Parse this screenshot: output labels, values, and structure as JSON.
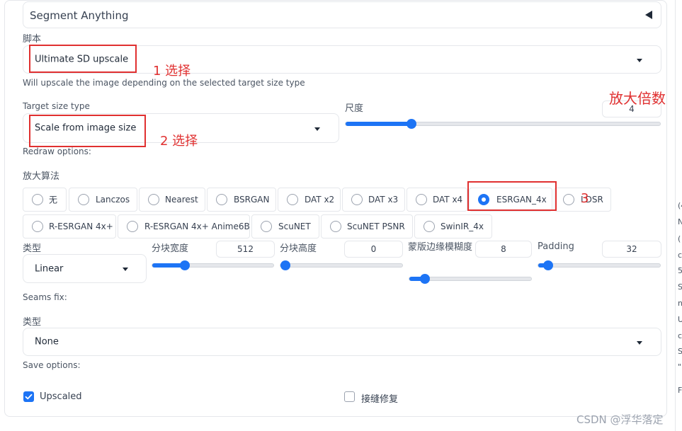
{
  "accordion": {
    "title": "Segment Anything"
  },
  "script": {
    "label": "脚本",
    "value": "Ultimate SD upscale",
    "hint": "Will upscale the image depending on the selected target size type"
  },
  "target": {
    "label": "Target size type",
    "value": "Scale from image size"
  },
  "scale": {
    "label": "尺度",
    "value": "4",
    "fraction": 0.21
  },
  "redraw": {
    "label": "Redraw options:"
  },
  "upscaler": {
    "label": "放大算法",
    "options": [
      "无",
      "Lanczos",
      "Nearest",
      "BSRGAN",
      "DAT x2",
      "DAT x3",
      "DAT x4",
      "ESRGAN_4x",
      "LDSR",
      "R-ESRGAN 4x+",
      "R-ESRGAN 4x+ Anime6B",
      "ScuNET",
      "ScuNET PSNR",
      "SwinIR_4x"
    ],
    "selected": "ESRGAN_4x"
  },
  "type": {
    "label": "类型",
    "value": "Linear"
  },
  "tile_width": {
    "label": "分块宽度",
    "value": "512",
    "fraction": 0.27
  },
  "tile_height": {
    "label": "分块高度",
    "value": "0",
    "fraction": 0.0
  },
  "mask_blur": {
    "label": "蒙版边缘模糊度",
    "value": "8",
    "fraction": 0.13
  },
  "padding": {
    "label": "Padding",
    "value": "32",
    "fraction": 0.08
  },
  "seams": {
    "label": "Seams fix:",
    "type_label": "类型",
    "value": "None"
  },
  "save": {
    "label": "Save options:",
    "upscaled": {
      "label": "Upscaled",
      "checked": true
    },
    "seams_fix": {
      "label": "接缝修复",
      "checked": false
    }
  },
  "annotations": {
    "step1": "1 选择",
    "step2": "2 选择",
    "step3": "3",
    "scale_note": "放大倍数"
  },
  "watermark": "CSDN @浮华落定",
  "side_chars": [
    "(4",
    "N",
    "(",
    "c",
    "5",
    "S",
    "n",
    "U",
    "c",
    "S",
    "\"",
    "F"
  ],
  "colors": {
    "accent": "#1d74f5",
    "annotation": "#e03030"
  }
}
